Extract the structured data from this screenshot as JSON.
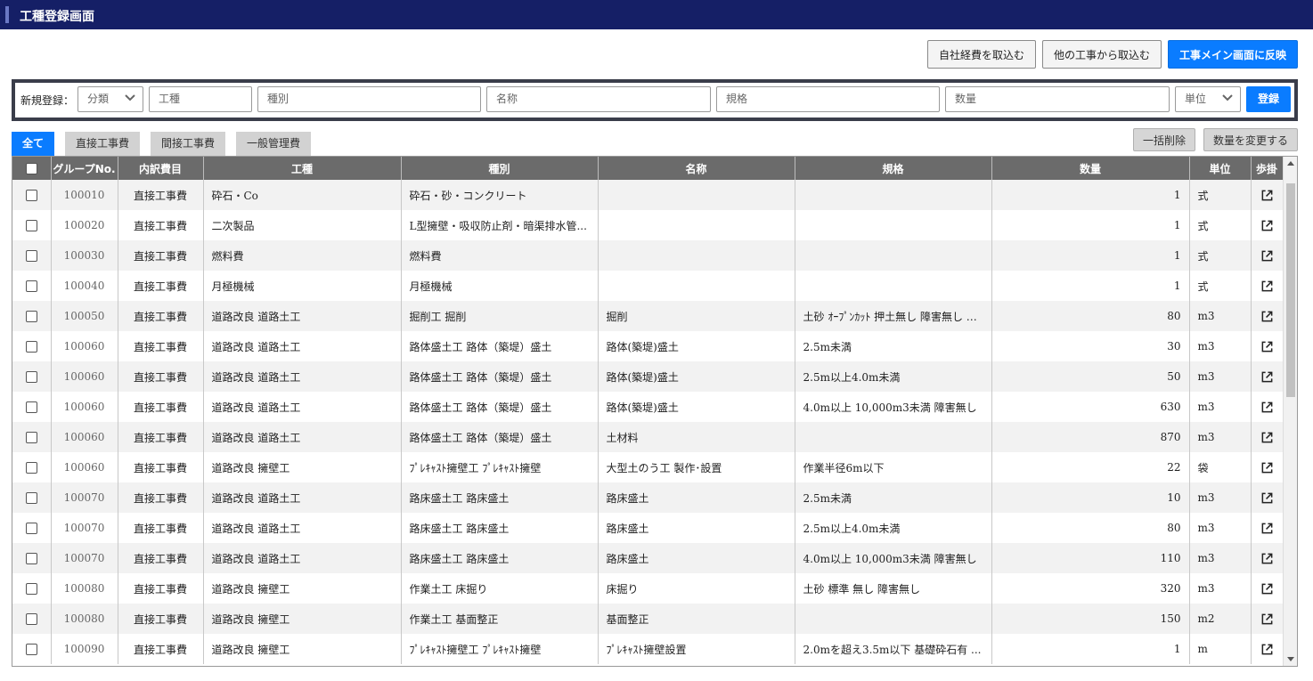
{
  "header": {
    "title": "工種登録画面",
    "accent_color": "#151f66"
  },
  "top_actions": {
    "import_own_expenses": "自社経費を取込む",
    "import_other_work": "他の工事から取込む",
    "reflect_main": "工事メイン画面に反映"
  },
  "registration": {
    "label": "新規登録：",
    "category_placeholder": "分類",
    "work_type_placeholder": "工種",
    "kind_placeholder": "種別",
    "name_placeholder": "名称",
    "spec_placeholder": "規格",
    "quantity_placeholder": "数量",
    "unit_placeholder": "単位",
    "submit_label": "登録"
  },
  "tabs": [
    {
      "label": "全て",
      "active": true
    },
    {
      "label": "直接工事費",
      "active": false
    },
    {
      "label": "間接工事費",
      "active": false
    },
    {
      "label": "一般管理費",
      "active": false
    }
  ],
  "table_actions": {
    "bulk_delete": "一括削除",
    "change_quantity": "数量を変更する"
  },
  "table": {
    "columns": {
      "group_no": "グループNo.",
      "breakdown": "内訳費目",
      "work_type": "工種",
      "kind": "種別",
      "name": "名称",
      "spec": "規格",
      "quantity": "数量",
      "unit": "単位",
      "rate": "歩掛"
    },
    "rows": [
      {
        "group": "100010",
        "cat": "直接工事費",
        "work": "砕石・Co",
        "kind": "砕石・砂・コンクリート",
        "name": "",
        "spec": "",
        "qty": "1",
        "unit": "式"
      },
      {
        "group": "100020",
        "cat": "直接工事費",
        "work": "二次製品",
        "kind": "L型擁壁・吸収防止剤・暗渠排水管...",
        "name": "",
        "spec": "",
        "qty": "1",
        "unit": "式"
      },
      {
        "group": "100030",
        "cat": "直接工事費",
        "work": "燃料費",
        "kind": "燃料費",
        "name": "",
        "spec": "",
        "qty": "1",
        "unit": "式"
      },
      {
        "group": "100040",
        "cat": "直接工事費",
        "work": "月極機械",
        "kind": "月極機械",
        "name": "",
        "spec": "",
        "qty": "1",
        "unit": "式"
      },
      {
        "group": "100050",
        "cat": "直接工事費",
        "work": "道路改良 道路土工",
        "kind": "掘削工 掘削",
        "name": "掘削",
        "spec": "土砂 ｵｰﾌﾟﾝｶｯﾄ 押土無し 障害無し 5,...",
        "qty": "80",
        "unit": "m3"
      },
      {
        "group": "100060",
        "cat": "直接工事費",
        "work": "道路改良 道路土工",
        "kind": "路体盛土工 路体（築堤）盛土",
        "name": "路体(築堤)盛土",
        "spec": "2.5m未満",
        "qty": "30",
        "unit": "m3"
      },
      {
        "group": "100060",
        "cat": "直接工事費",
        "work": "道路改良 道路土工",
        "kind": "路体盛土工 路体（築堤）盛土",
        "name": "路体(築堤)盛土",
        "spec": "2.5m以上4.0m未満",
        "qty": "50",
        "unit": "m3"
      },
      {
        "group": "100060",
        "cat": "直接工事費",
        "work": "道路改良 道路土工",
        "kind": "路体盛土工 路体（築堤）盛土",
        "name": "路体(築堤)盛土",
        "spec": "4.0m以上 10,000m3未満 障害無し",
        "qty": "630",
        "unit": "m3"
      },
      {
        "group": "100060",
        "cat": "直接工事費",
        "work": "道路改良 道路土工",
        "kind": "路体盛土工 路体（築堤）盛土",
        "name": "土材料",
        "spec": "",
        "qty": "870",
        "unit": "m3"
      },
      {
        "group": "100060",
        "cat": "直接工事費",
        "work": "道路改良 擁壁工",
        "kind": "ﾌﾟﾚｷｬｽﾄ擁壁工 ﾌﾟﾚｷｬｽﾄ擁壁",
        "name": "大型土のう工 製作･設置",
        "spec": "作業半径6m以下",
        "qty": "22",
        "unit": "袋"
      },
      {
        "group": "100070",
        "cat": "直接工事費",
        "work": "道路改良 道路土工",
        "kind": "路床盛土工 路床盛土",
        "name": "路床盛土",
        "spec": "2.5m未満",
        "qty": "10",
        "unit": "m3"
      },
      {
        "group": "100070",
        "cat": "直接工事費",
        "work": "道路改良 道路土工",
        "kind": "路床盛土工 路床盛土",
        "name": "路床盛土",
        "spec": "2.5m以上4.0m未満",
        "qty": "80",
        "unit": "m3"
      },
      {
        "group": "100070",
        "cat": "直接工事費",
        "work": "道路改良 道路土工",
        "kind": "路床盛土工 路床盛土",
        "name": "路床盛土",
        "spec": "4.0m以上 10,000m3未満 障害無し",
        "qty": "110",
        "unit": "m3"
      },
      {
        "group": "100080",
        "cat": "直接工事費",
        "work": "道路改良 擁壁工",
        "kind": "作業土工 床掘り",
        "name": "床掘り",
        "spec": "土砂 標準 無し 障害無し",
        "qty": "320",
        "unit": "m3"
      },
      {
        "group": "100080",
        "cat": "直接工事費",
        "work": "道路改良 擁壁工",
        "kind": "作業土工 基面整正",
        "name": "基面整正",
        "spec": "",
        "qty": "150",
        "unit": "m2"
      },
      {
        "group": "100090",
        "cat": "直接工事費",
        "work": "道路改良 擁壁工",
        "kind": "ﾌﾟﾚｷｬｽﾄ擁壁工 ﾌﾟﾚｷｬｽﾄ擁壁",
        "name": "ﾌﾟﾚｷｬｽﾄ擁壁設置",
        "spec": "2.0mを超え3.5m以下 基礎砕石有 ...",
        "qty": "1",
        "unit": "m"
      }
    ]
  }
}
